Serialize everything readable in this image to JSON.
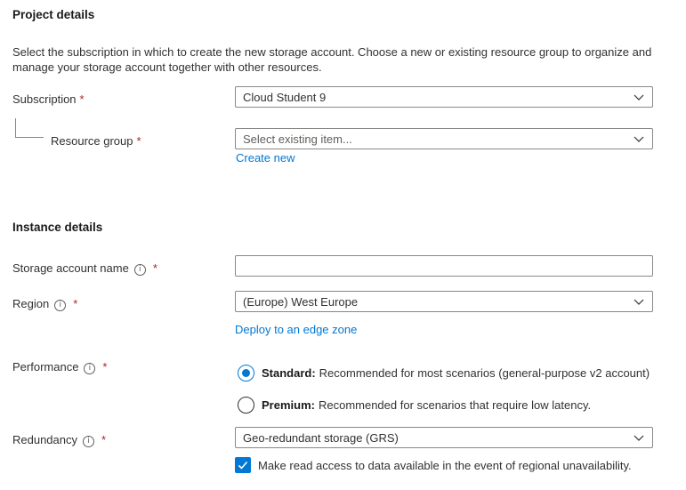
{
  "project": {
    "heading": "Project details",
    "description": "Select the subscription in which to create the new storage account. Choose a new or existing resource group to organize and manage your storage account together with other resources.",
    "subscription": {
      "label": "Subscription",
      "value": "Cloud Student 9"
    },
    "resource_group": {
      "label": "Resource group",
      "placeholder": "Select existing item...",
      "create_new": "Create new"
    }
  },
  "instance": {
    "heading": "Instance details",
    "storage_name": {
      "label": "Storage account name",
      "value": ""
    },
    "region": {
      "label": "Region",
      "value": "(Europe) West Europe",
      "edge_link": "Deploy to an edge zone"
    },
    "performance": {
      "label": "Performance",
      "options": [
        {
          "name": "Standard:",
          "desc": "Recommended for most scenarios (general-purpose v2 account)",
          "selected": true
        },
        {
          "name": "Premium:",
          "desc": "Recommended for scenarios that require low latency.",
          "selected": false
        }
      ]
    },
    "redundancy": {
      "label": "Redundancy",
      "value": "Geo-redundant storage (GRS)",
      "read_access_label": "Make read access to data available in the event of regional unavailability.",
      "read_access_checked": true
    }
  },
  "common": {
    "required_mark": "*",
    "info_glyph": "i"
  },
  "colors": {
    "accent": "#0078d4",
    "required": "#a4262c",
    "border": "#8a8886",
    "text": "#323130"
  },
  "icons": {
    "dropdown": "chevron-down-icon",
    "info": "info-icon",
    "check": "checkmark-icon"
  }
}
